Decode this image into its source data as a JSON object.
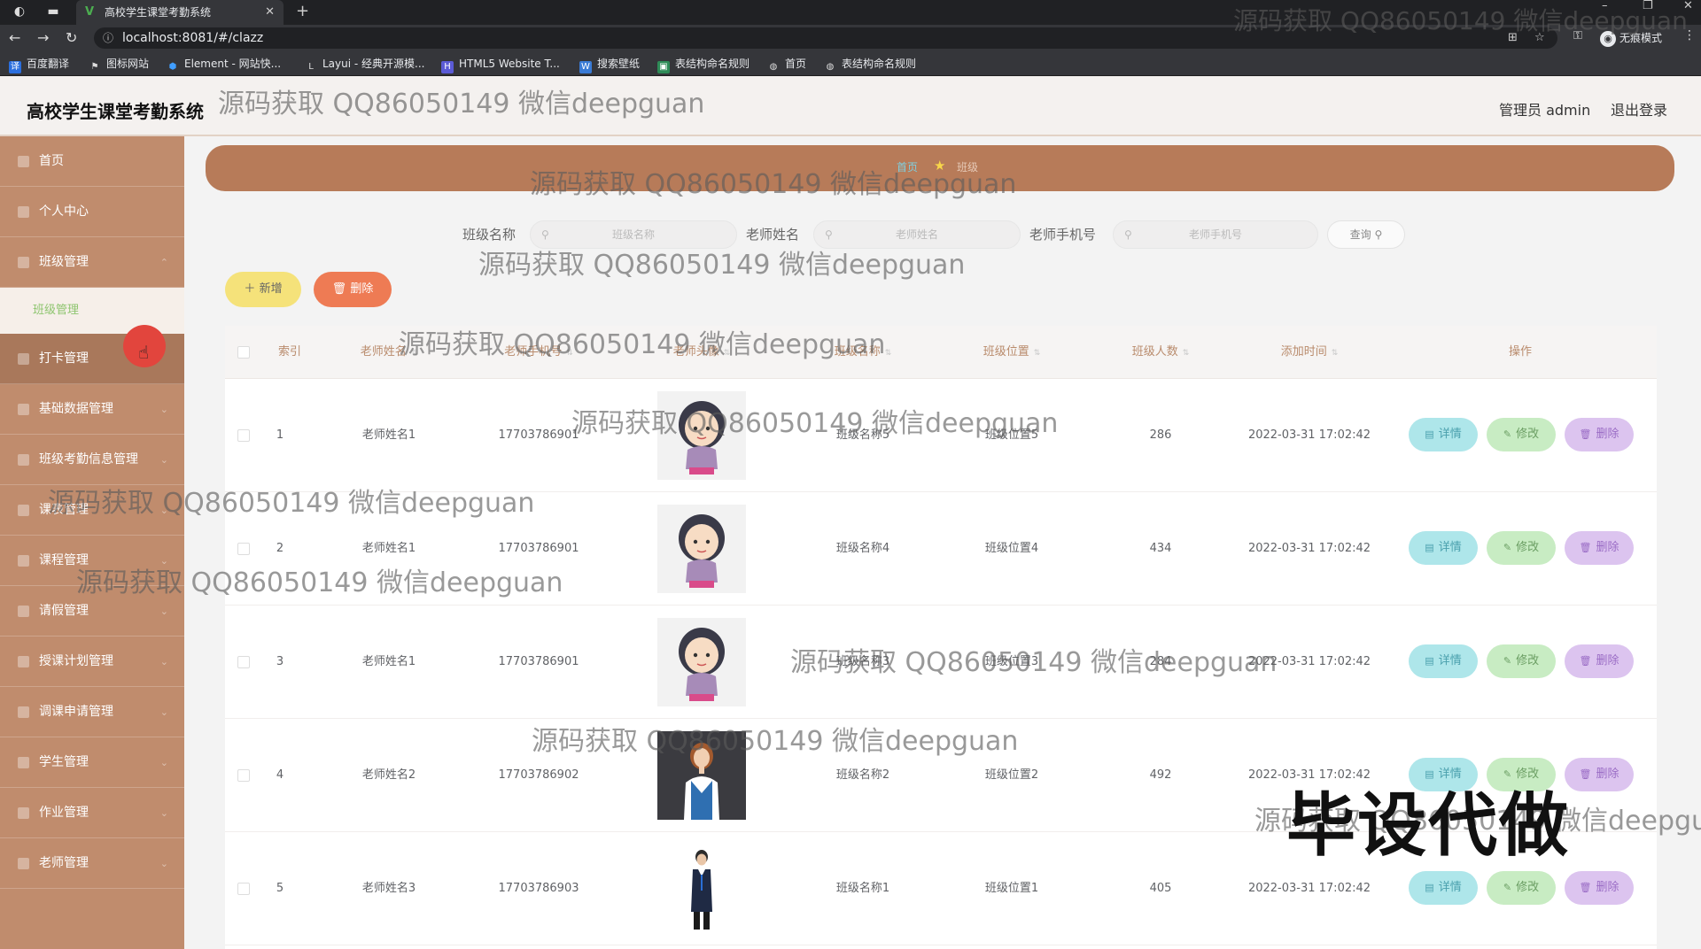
{
  "browser": {
    "tab_title": "高校学生课堂考勤系统",
    "tab_favicon": "V",
    "url": "localhost:8081/#/clazz",
    "incognito_label": "无痕模式",
    "bookmarks": [
      {
        "label": "百度翻译",
        "icon": "译",
        "color": "#2b6fde"
      },
      {
        "label": "图标网站",
        "icon": "⚑",
        "color": "#444"
      },
      {
        "label": "Element - 网站快...",
        "icon": "⬢",
        "color": "#409eff"
      },
      {
        "label": "Layui - 经典开源模...",
        "icon": "L",
        "color": "#555"
      },
      {
        "label": "HTML5 Website T...",
        "icon": "H",
        "color": "#5b5bd6"
      },
      {
        "label": "搜索壁纸",
        "icon": "W",
        "color": "#3a7bd5"
      },
      {
        "label": "表结构命名规则",
        "icon": "▣",
        "color": "#2e8b57"
      },
      {
        "label": "首页",
        "icon": "◍",
        "color": "#666"
      },
      {
        "label": "表结构命名规则",
        "icon": "◍",
        "color": "#666"
      }
    ]
  },
  "header": {
    "title": "高校学生课堂考勤系统",
    "user": "管理员 admin",
    "logout": "退出登录"
  },
  "sidebar": {
    "items": [
      {
        "label": "首页"
      },
      {
        "label": "个人中心"
      },
      {
        "label": "班级管理"
      },
      {
        "label": "打卡管理"
      },
      {
        "label": "基础数据管理"
      },
      {
        "label": "班级考勤信息管理"
      },
      {
        "label": "课表管理"
      },
      {
        "label": "课程管理"
      },
      {
        "label": "请假管理"
      },
      {
        "label": "授课计划管理"
      },
      {
        "label": "调课申请管理"
      },
      {
        "label": "学生管理"
      },
      {
        "label": "作业管理"
      },
      {
        "label": "老师管理"
      }
    ],
    "sub_item": "班级管理"
  },
  "breadcrumb": {
    "home": "首页",
    "current": "班级"
  },
  "search": {
    "class_name_label": "班级名称",
    "class_name_placeholder": "班级名称",
    "teacher_name_label": "老师姓名",
    "teacher_name_placeholder": "老师姓名",
    "teacher_phone_label": "老师手机号",
    "teacher_phone_placeholder": "老师手机号",
    "query_button": "查询"
  },
  "toolbar": {
    "add": "新增",
    "delete": "删除"
  },
  "table": {
    "headers": {
      "index": "索引",
      "teacher_name": "老师姓名",
      "teacher_phone": "老师手机号",
      "teacher_avatar": "老师头像",
      "class_name": "班级名称",
      "class_location": "班级位置",
      "class_size": "班级人数",
      "added_time": "添加时间",
      "actions": "操作"
    },
    "rows": [
      {
        "index": "1",
        "teacher_name": "老师姓名1",
        "teacher_phone": "17703786901",
        "avatar": "girl-cartoon",
        "class_name": "班级名称5",
        "class_location": "班级位置5",
        "class_size": "286",
        "added_time": "2022-03-31 17:02:42"
      },
      {
        "index": "2",
        "teacher_name": "老师姓名1",
        "teacher_phone": "17703786901",
        "avatar": "girl-cartoon",
        "class_name": "班级名称4",
        "class_location": "班级位置4",
        "class_size": "434",
        "added_time": "2022-03-31 17:02:42"
      },
      {
        "index": "3",
        "teacher_name": "老师姓名1",
        "teacher_phone": "17703786901",
        "avatar": "girl-cartoon",
        "class_name": "班级名称3",
        "class_location": "班级位置3",
        "class_size": "284",
        "added_time": "2022-03-31 17:02:42"
      },
      {
        "index": "4",
        "teacher_name": "老师姓名2",
        "teacher_phone": "17703786902",
        "avatar": "woman-photo",
        "class_name": "班级名称2",
        "class_location": "班级位置2",
        "class_size": "492",
        "added_time": "2022-03-31 17:02:42"
      },
      {
        "index": "5",
        "teacher_name": "老师姓名3",
        "teacher_phone": "17703786903",
        "avatar": "man-suit",
        "class_name": "班级名称1",
        "class_location": "班级位置1",
        "class_size": "405",
        "added_time": "2022-03-31 17:02:42"
      }
    ],
    "action_labels": {
      "detail": "详情",
      "edit": "修改",
      "delete": "删除"
    }
  },
  "watermark_text": "源码获取 QQ86050149 微信deepguan",
  "stamp_text": "毕设代做",
  "colors": {
    "sidebar": "#c08c6d",
    "breadcrumb_bar": "#b77b59",
    "add_button": "#f5e27a",
    "delete_button": "#ee7b54",
    "detail_button": "#aee6ea",
    "edit_button": "#c8ecc3",
    "row_delete_button": "#dcc4ef"
  }
}
